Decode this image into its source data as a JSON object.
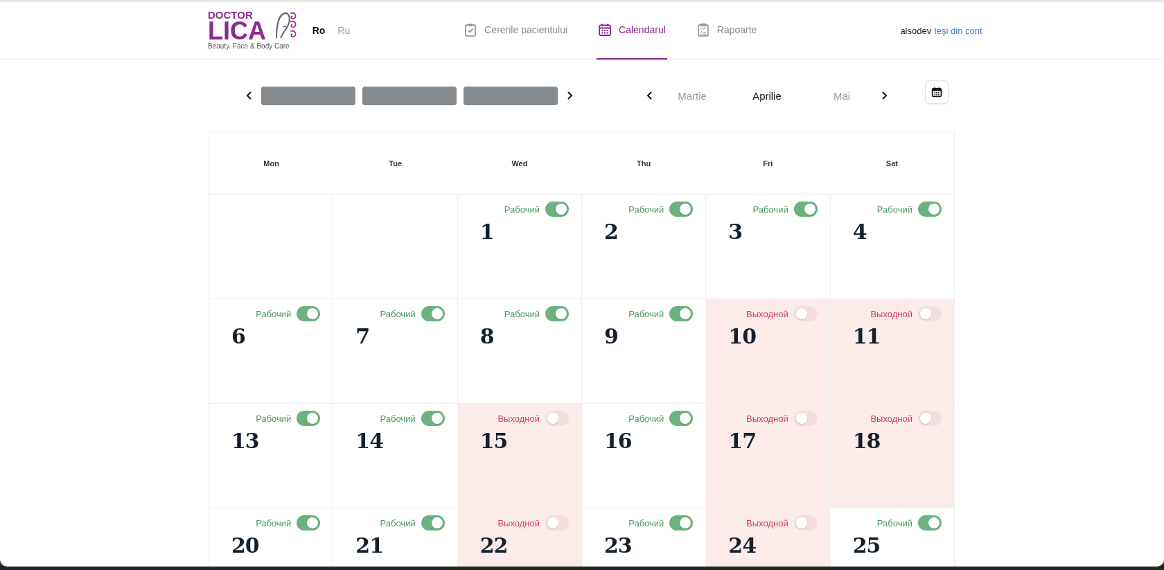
{
  "logo": {
    "line1": "DOCTOR",
    "line2": "LICA",
    "tagline": "Beauty. Face & Body Care"
  },
  "languages": [
    {
      "label": "Ro",
      "selected": true
    },
    {
      "label": "Ru",
      "selected": false
    }
  ],
  "nav": [
    {
      "label": "Cererile pacientului",
      "selected": false
    },
    {
      "label": "Calendarul",
      "selected": true
    },
    {
      "label": "Rapoarte",
      "selected": false
    }
  ],
  "user": {
    "name": "alsodev",
    "logout": "Ieşi din cont"
  },
  "months": [
    {
      "label": "Martie",
      "selected": false
    },
    {
      "label": "Aprilie",
      "selected": true
    },
    {
      "label": "Mai",
      "selected": false
    }
  ],
  "weekdays": [
    "Mon",
    "Tue",
    "Wed",
    "Thu",
    "Fri",
    "Sat"
  ],
  "weeks": [
    [
      {
        "kind": "empty"
      },
      {
        "kind": "empty"
      },
      {
        "kind": "day",
        "day": "1",
        "status": "Рабочий",
        "on": true
      },
      {
        "kind": "day",
        "day": "2",
        "status": "Рабочий",
        "on": true
      },
      {
        "kind": "day",
        "day": "3",
        "status": "Рабочий",
        "on": true
      },
      {
        "kind": "day",
        "day": "4",
        "status": "Рабочий",
        "on": true
      }
    ],
    [
      {
        "kind": "day",
        "day": "6",
        "status": "Рабочий",
        "on": true
      },
      {
        "kind": "day",
        "day": "7",
        "status": "Рабочий",
        "on": true
      },
      {
        "kind": "day",
        "day": "8",
        "status": "Рабочий",
        "on": true
      },
      {
        "kind": "day",
        "day": "9",
        "status": "Рабочий",
        "on": true
      },
      {
        "kind": "day",
        "day": "10",
        "status": "Выходной",
        "on": false
      },
      {
        "kind": "day",
        "day": "11",
        "status": "Выходной",
        "on": false
      }
    ],
    [
      {
        "kind": "day",
        "day": "13",
        "status": "Рабочий",
        "on": true
      },
      {
        "kind": "day",
        "day": "14",
        "status": "Рабочий",
        "on": true
      },
      {
        "kind": "day",
        "day": "15",
        "status": "Выходной",
        "on": false
      },
      {
        "kind": "day",
        "day": "16",
        "status": "Рабочий",
        "on": true
      },
      {
        "kind": "day",
        "day": "17",
        "status": "Выходной",
        "on": false
      },
      {
        "kind": "day",
        "day": "18",
        "status": "Выходной",
        "on": false
      }
    ],
    [
      {
        "kind": "day",
        "day": "20",
        "status": "Рабочий",
        "on": true
      },
      {
        "kind": "day",
        "day": "21",
        "status": "Рабочий",
        "on": true
      },
      {
        "kind": "day",
        "day": "22",
        "status": "Выходной",
        "on": false
      },
      {
        "kind": "day",
        "day": "23",
        "status": "Рабочий",
        "on": true
      },
      {
        "kind": "day",
        "day": "24",
        "status": "Выходной",
        "on": false
      },
      {
        "kind": "day",
        "day": "25",
        "status": "Рабочий",
        "on": true
      }
    ]
  ]
}
